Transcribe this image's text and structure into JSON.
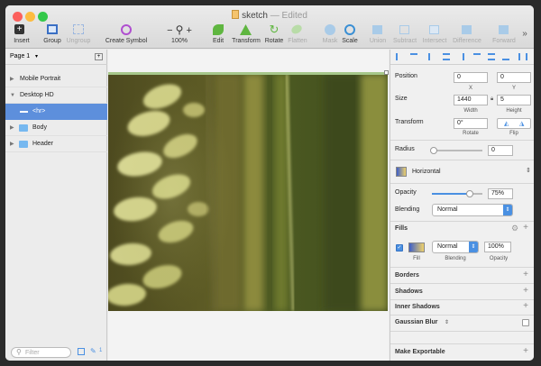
{
  "window": {
    "title": "sketch",
    "status": "— Edited"
  },
  "toolbar": {
    "insert": "Insert",
    "group": "Group",
    "ungroup": "Ungroup",
    "create_symbol": "Create Symbol",
    "zoom": "100%",
    "edit": "Edit",
    "transform": "Transform",
    "rotate": "Rotate",
    "flatten": "Flatten",
    "mask": "Mask",
    "scale": "Scale",
    "union": "Union",
    "subtract": "Subtract",
    "intersect": "Intersect",
    "difference": "Difference",
    "forward": "Forward"
  },
  "layers": {
    "page": "Page 1",
    "items": [
      {
        "label": "Mobile Portrait"
      },
      {
        "label": "Desktop HD"
      },
      {
        "label": "<hr>"
      },
      {
        "label": "Body"
      },
      {
        "label": "Header"
      }
    ],
    "filter_placeholder": "Filter",
    "count": "1"
  },
  "inspector": {
    "position_label": "Position",
    "pos_x": "0",
    "pos_y": "0",
    "x_label": "X",
    "y_label": "Y",
    "size_label": "Size",
    "width": "1440",
    "height": "5",
    "width_label": "Width",
    "height_label": "Height",
    "transform_label": "Transform",
    "rotate_value": "0°",
    "rotate_label": "Rotate",
    "flip_label": "Flip",
    "radius_label": "Radius",
    "radius_value": "0",
    "gradient_type": "Horizontal",
    "opacity_label": "Opacity",
    "opacity_value": "75%",
    "opacity_fraction": 0.75,
    "blending_label": "Blending",
    "blending_value": "Normal",
    "fills_label": "Fills",
    "fill_blend": "Normal",
    "fill_opacity": "100%",
    "fill_col": "Fill",
    "blending_col": "Blending",
    "opacity_col": "Opacity",
    "borders": "Borders",
    "shadows": "Shadows",
    "inner_shadows": "Inner Shadows",
    "gaussian_blur": "Gaussian Blur",
    "make_exportable": "Make Exportable"
  }
}
